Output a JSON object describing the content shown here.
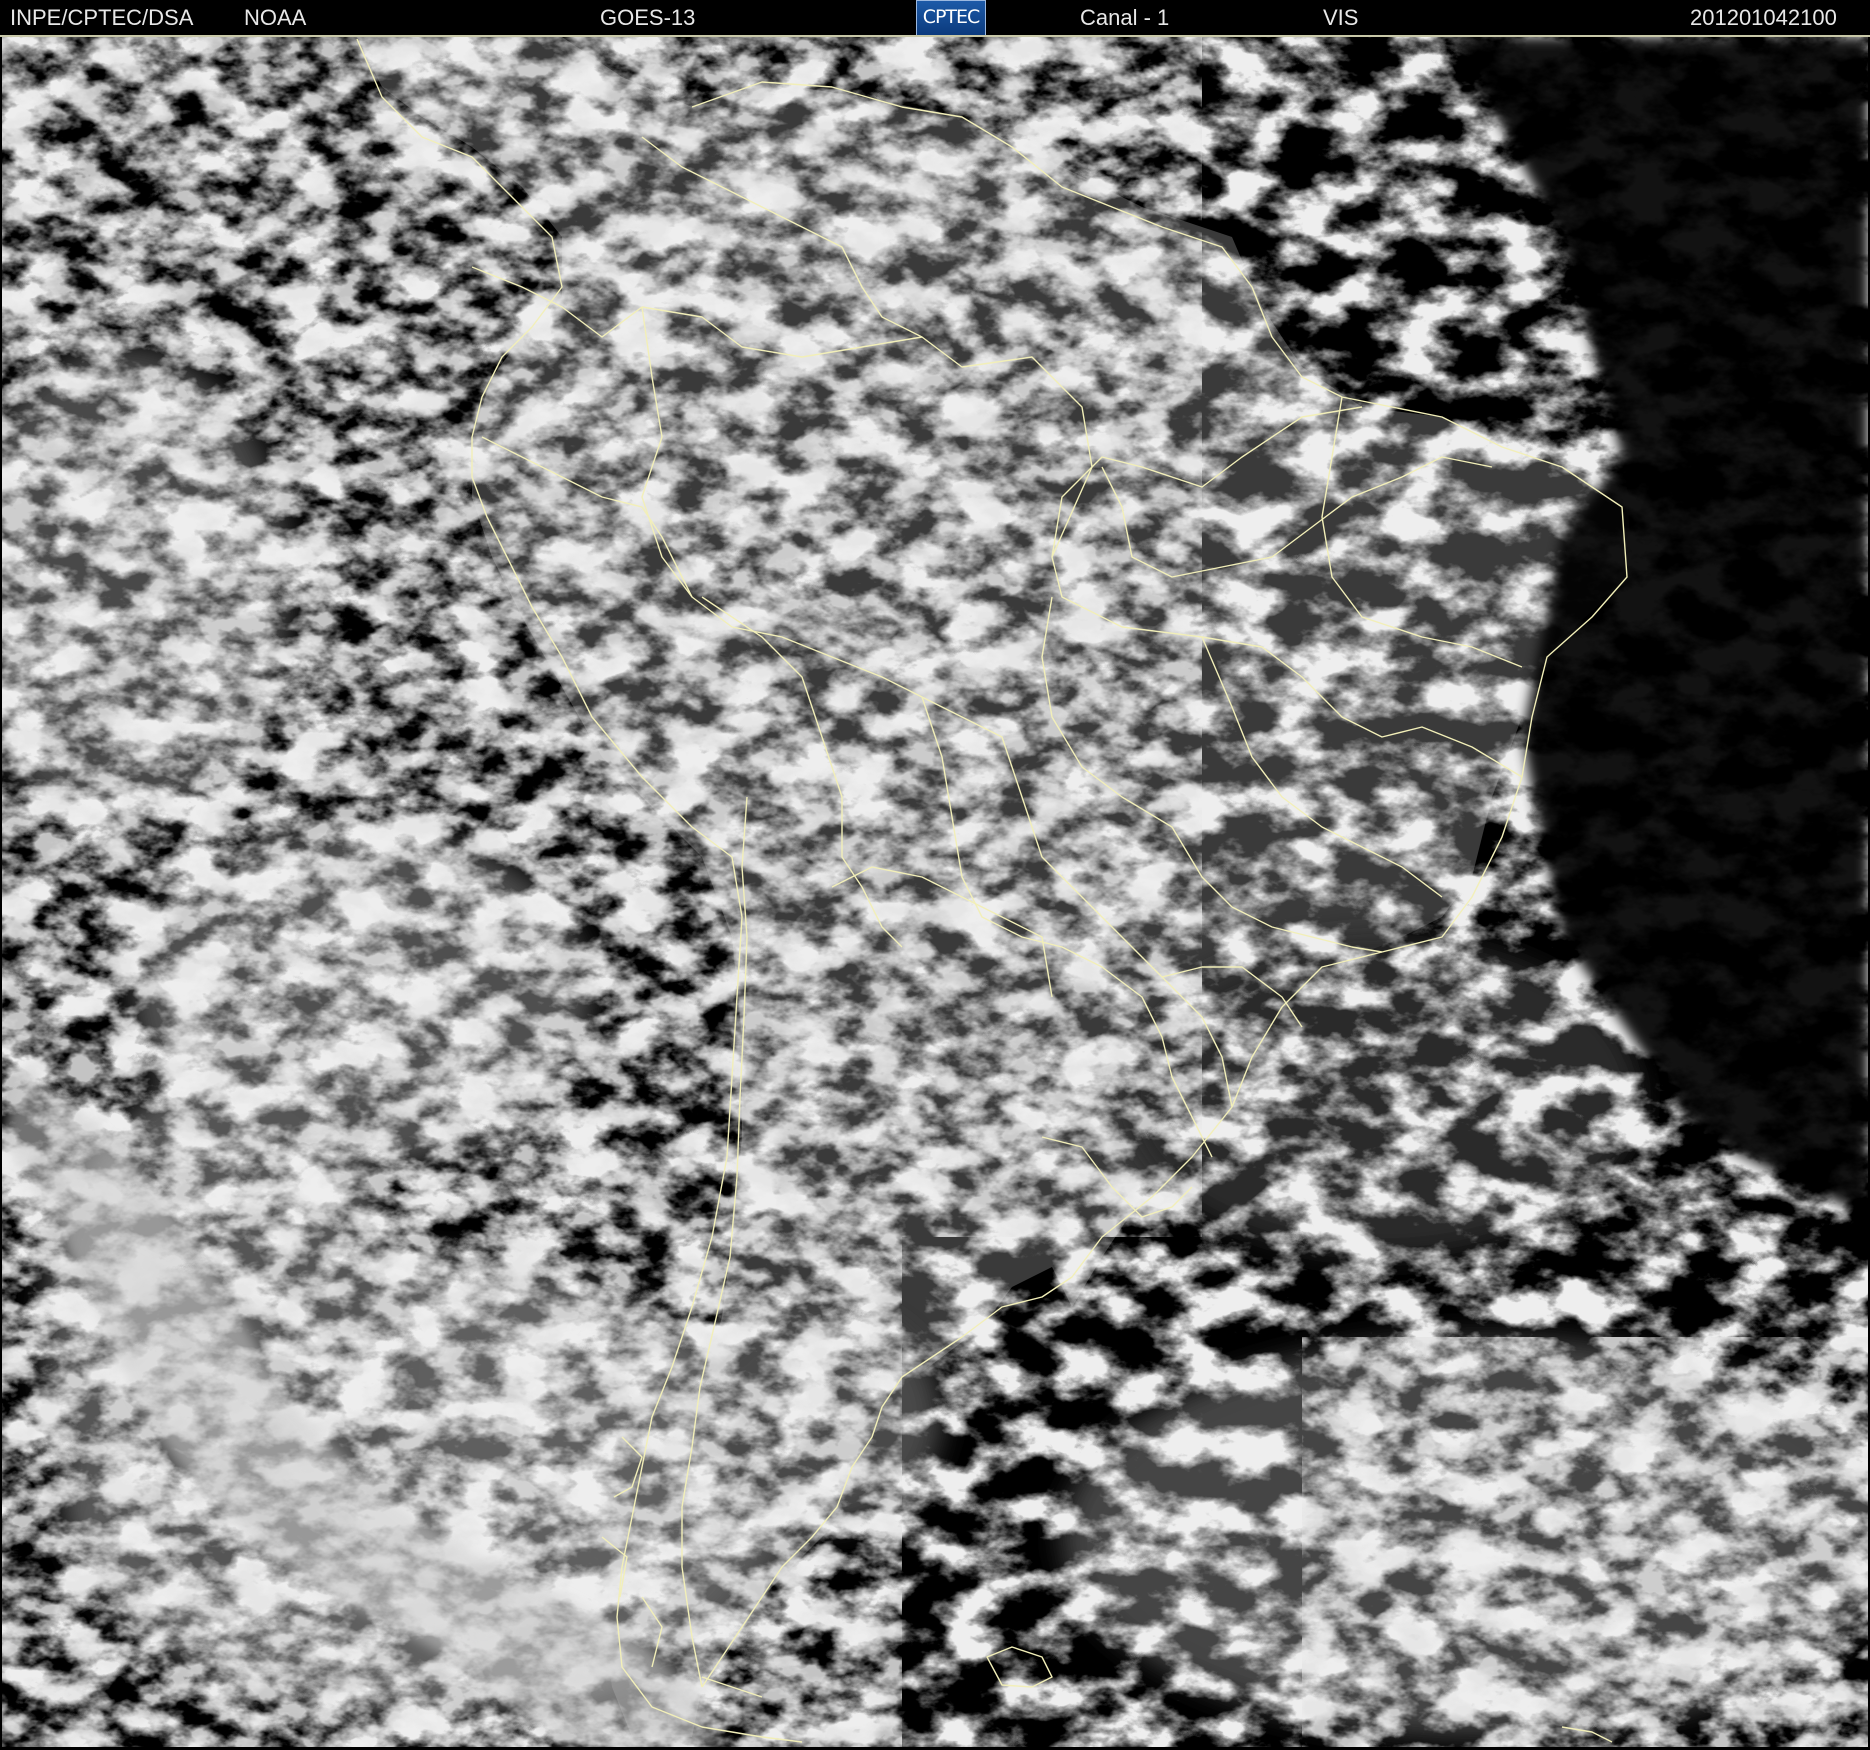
{
  "header": {
    "org": "INPE/CPTEC/DSA",
    "agency": "NOAA",
    "satellite": "GOES-13",
    "logo_text": "CPTEC",
    "channel": "Canal - 1",
    "band": "VIS",
    "timestamp": "201201042100"
  },
  "image": {
    "overlay_color": "#f2efb8",
    "cloud_color": "#d9d9d9",
    "land_shade": "#5a5a5a",
    "ocean_color": "#000000"
  }
}
